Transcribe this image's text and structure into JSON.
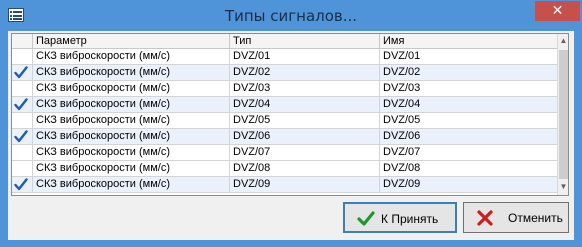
{
  "window": {
    "title": "Типы сигналов...",
    "close_glyph": "✕"
  },
  "table": {
    "columns": [
      "",
      "Параметр",
      "Тип",
      "Имя"
    ],
    "rows": [
      {
        "checked": false,
        "param": "СКЗ виброскорости (мм/с)",
        "type": "DVZ/01",
        "name": "DVZ/01"
      },
      {
        "checked": true,
        "param": "СКЗ виброскорости (мм/с)",
        "type": "DVZ/02",
        "name": "DVZ/02"
      },
      {
        "checked": false,
        "param": "СКЗ виброскорости (мм/с)",
        "type": "DVZ/03",
        "name": "DVZ/03"
      },
      {
        "checked": true,
        "param": "СКЗ виброскорости (мм/с)",
        "type": "DVZ/04",
        "name": "DVZ/04"
      },
      {
        "checked": false,
        "param": "СКЗ виброскорости (мм/с)",
        "type": "DVZ/05",
        "name": "DVZ/05"
      },
      {
        "checked": true,
        "param": "СКЗ виброскорости (мм/с)",
        "type": "DVZ/06",
        "name": "DVZ/06"
      },
      {
        "checked": false,
        "param": "СКЗ виброскорости (мм/с)",
        "type": "DVZ/07",
        "name": "DVZ/07"
      },
      {
        "checked": false,
        "param": "СКЗ виброскорости (мм/с)",
        "type": "DVZ/08",
        "name": "DVZ/08"
      },
      {
        "checked": true,
        "param": "СКЗ виброскорости (мм/с)",
        "type": "DVZ/09",
        "name": "DVZ/09"
      }
    ]
  },
  "buttons": {
    "ok_label": "К Принять",
    "cancel_label": "Отменить"
  },
  "colors": {
    "titlebar": "#4f93d8",
    "close": "#c7504a",
    "check": "#1e5bb5",
    "alt_row": "#eaf1fb"
  },
  "icons": {
    "system": "list-window-icon",
    "check": "checkmark-icon",
    "ok": "green-check-icon",
    "cancel": "red-x-icon"
  }
}
